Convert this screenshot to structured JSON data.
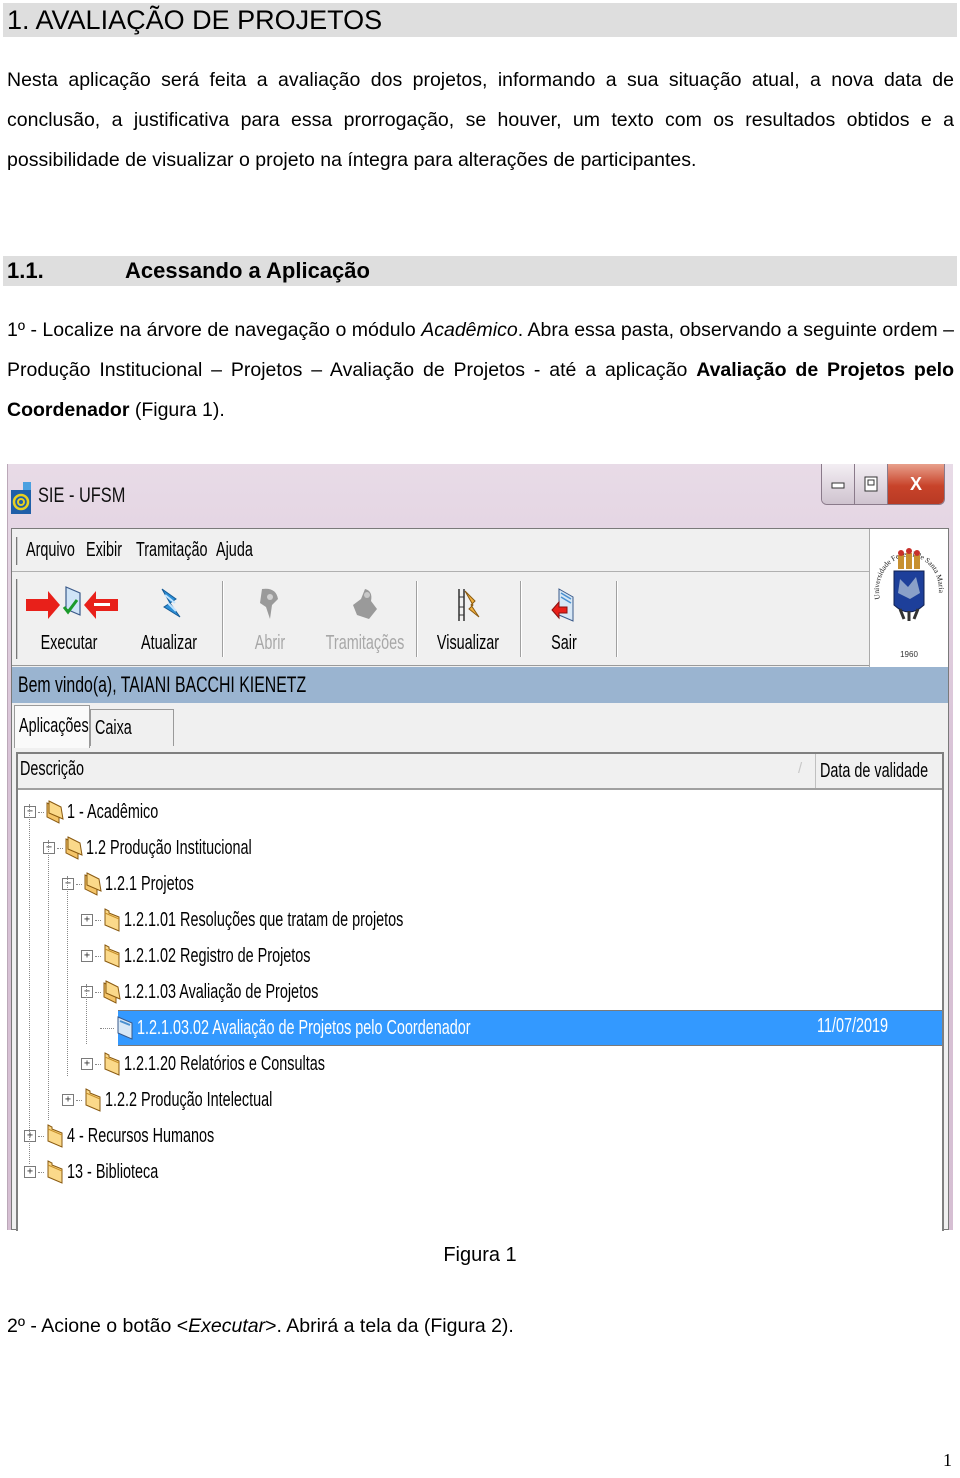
{
  "document": {
    "heading1": "1. AVALIAÇÃO DE PROJETOS",
    "intro_paragraph": "Nesta aplicação será feita a avaliação dos projetos, informando a sua situação atual, a nova data de conclusão, a justificativa para essa prorrogação, se houver, um texto com os resultados obtidos e a possibilidade de visualizar o projeto na íntegra para alterações de participantes.",
    "heading2": {
      "number": "1.1.",
      "title": "Acessando a Aplicação"
    },
    "step1": {
      "prefix": "1º - Localize na árvore de navegação o módulo ",
      "italic": "Acadêmico",
      "middle": ". Abra essa pasta, observando a seguinte ordem – Produção Institucional – Projetos – Avaliação de Projetos - até a aplicação ",
      "bold": "Avaliação de Projetos pelo Coordenador",
      "suffix": " (Figura 1)."
    },
    "figure_caption": "Figura 1",
    "step2": {
      "prefix": "2º - Acione o botão <",
      "italic": "Executar",
      "suffix": ">. Abrirá a tela da (Figura 2)."
    },
    "page_number": "1"
  },
  "screenshot": {
    "window_title": "SIE - UFSM",
    "window_controls": {
      "minimize": "minimize",
      "maximize": "maximize",
      "close": "X"
    },
    "menu": [
      "Arquivo",
      "Exibir",
      "Tramitação",
      "Ajuda"
    ],
    "toolbar": [
      {
        "label": "Executar",
        "icon": "execute-icon",
        "enabled": true
      },
      {
        "label": "Atualizar",
        "icon": "refresh-icon",
        "enabled": true
      },
      {
        "label": "Abrir",
        "icon": "open-icon",
        "enabled": false
      },
      {
        "label": "Tramitações",
        "icon": "workflow-icon",
        "enabled": false
      },
      {
        "label": "Visualizar",
        "icon": "view-icon",
        "enabled": true
      },
      {
        "label": "Sair",
        "icon": "exit-icon",
        "enabled": true
      }
    ],
    "logo": {
      "text_arc": "Universidade Federal de Santa Maria",
      "year": "1960"
    },
    "welcome": "Bem vindo(a), TAIANI BACCHI KIENETZ",
    "tabs": [
      {
        "label": "Aplicações",
        "active": true
      },
      {
        "label": "Caixa Postal",
        "active": false
      }
    ],
    "columns": {
      "description": "Descrição",
      "sort_indicator": "/",
      "validity": "Data de validade"
    },
    "tree": [
      {
        "level": 0,
        "label": "1 - Acadêmico",
        "expander": "−",
        "type": "folder-open"
      },
      {
        "level": 1,
        "label": "1.2 Produção Institucional",
        "expander": "−",
        "type": "folder-open"
      },
      {
        "level": 2,
        "label": "1.2.1 Projetos",
        "expander": "−",
        "type": "folder-open"
      },
      {
        "level": 3,
        "label": "1.2.1.01 Resoluções que tratam de projetos",
        "expander": "+",
        "type": "folder"
      },
      {
        "level": 3,
        "label": "1.2.1.02 Registro de Projetos",
        "expander": "+",
        "type": "folder"
      },
      {
        "level": 3,
        "label": "1.2.1.03 Avaliação de Projetos",
        "expander": "−",
        "type": "folder-open"
      },
      {
        "level": 4,
        "label": "1.2.1.03.02 Avaliação de Projetos pelo Coordenador",
        "expander": "",
        "type": "application",
        "date": "11/07/2019",
        "selected": true
      },
      {
        "level": 3,
        "label": "1.2.1.20 Relatórios e Consultas",
        "expander": "+",
        "type": "folder"
      },
      {
        "level": 2,
        "label": "1.2.2 Produção Intelectual",
        "expander": "+",
        "type": "folder"
      },
      {
        "level": 0,
        "label": "4 - Recursos Humanos",
        "expander": "+",
        "type": "folder"
      },
      {
        "level": 0,
        "label": "13 - Biblioteca",
        "expander": "+",
        "type": "folder"
      }
    ],
    "colors": {
      "selection": "#3399ff",
      "welcome_bar": "#9ab4d0",
      "title_bar": "#d8c2d6",
      "annotation_arrow": "#e8201a"
    }
  }
}
